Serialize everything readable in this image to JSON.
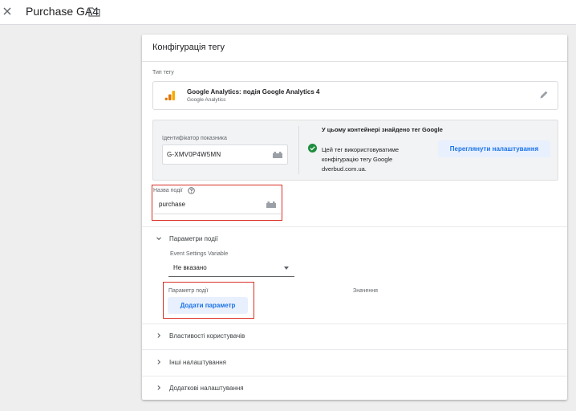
{
  "header": {
    "title": "Purchase GA4",
    "icons": [
      "close-icon",
      "folder-icon"
    ]
  },
  "card": {
    "title": "Конфігурація тегу",
    "tag_type": {
      "label": "Тип тегу",
      "name": "Google Analytics: подія Google Analytics 4",
      "subtitle": "Google Analytics",
      "icons": [
        "google-analytics-icon",
        "pencil-icon"
      ]
    },
    "google_tag": {
      "id_label": "Ідентифікатор показника",
      "id_value": "G-XMV0P4W5MN",
      "found_heading": "У цьому контейнері знайдено тег Google",
      "found_body": "Цей тег використовуватиме конфігурацію тегу Google dverbud.com.ua.",
      "view_button": "Переглянути налаштування"
    },
    "event_name": {
      "label": "Назва події",
      "value": "purchase"
    },
    "event_parameters": {
      "section_label": "Параметри події",
      "settings_variable_label": "Event Settings Variable",
      "settings_variable_value": "Не вказано",
      "param_column": "Параметр події",
      "value_column": "Значення",
      "add_button": "Додати параметр"
    },
    "sections": [
      {
        "label": "Властивості користувачів"
      },
      {
        "label": "Інші налаштування"
      },
      {
        "label": "Додаткові налаштування"
      }
    ]
  },
  "colors": {
    "accent": "#1a73e8",
    "accent_bg": "#e8f0fe",
    "highlight_red": "#d93025",
    "success_green": "#1e8e3e",
    "ga_orange": "#f9ab00",
    "ga_dark_orange": "#e37400"
  }
}
